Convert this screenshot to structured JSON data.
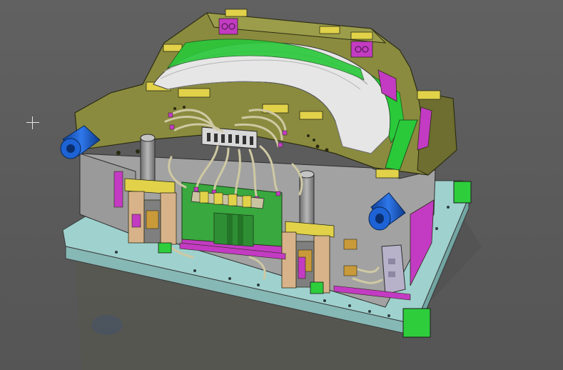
{
  "viewport": {
    "background": "#5f5f5f",
    "cursor_icon": "crosshair-cursor-icon"
  },
  "model": {
    "colors": {
      "base_plate": "#a9dbd8",
      "base_plate_dark": "#7fb7b4",
      "mold_body": "#8a8b3e",
      "mold_body_dark": "#6d6e2f",
      "housing_gray": "#a6a6a6",
      "cavity": "#e9e9e9",
      "cavity_shade": "#c9c9c9",
      "accent_green": "#29c93a",
      "accent_magenta": "#c23bc2",
      "accent_yellow": "#e1d24a",
      "blue_cylinder": "#1a5fd1",
      "hoses": "#cfc9a3",
      "pcb_green": "#39a83e",
      "wood_block": "#d8b38a"
    }
  }
}
